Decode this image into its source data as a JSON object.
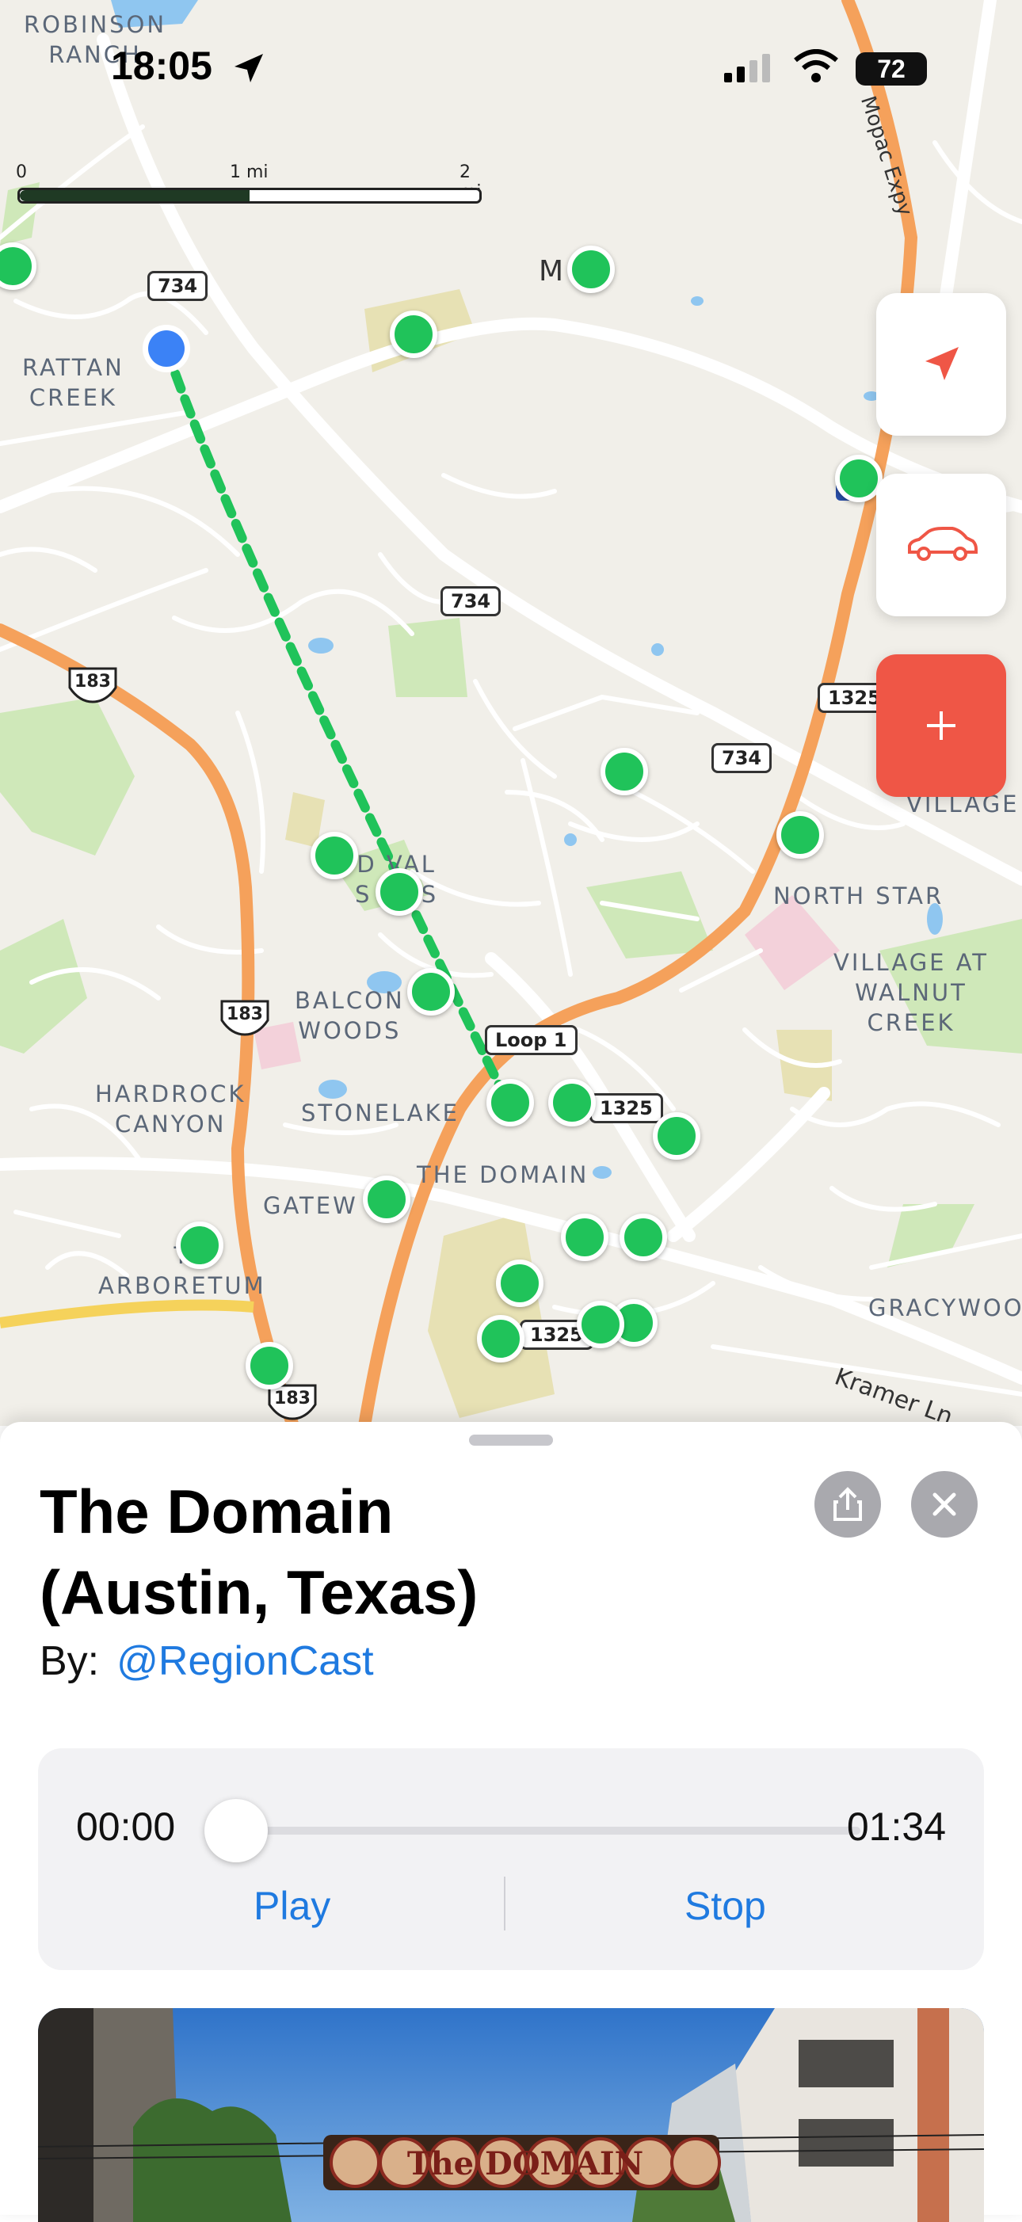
{
  "status_bar": {
    "time": "18:05",
    "battery": "72"
  },
  "scale": {
    "labels": [
      "0",
      "1 mi",
      "2 mi"
    ]
  },
  "map": {
    "places": [
      "ROBINSON\nRANCH",
      "RATTAN\nCREEK",
      "D VAL\nS NGS",
      "BALCON\nWOODS",
      "HARDROCK\nCANYON",
      "STONELAKE",
      "THE DOMAIN",
      "GATEW",
      "T\nARBORETUM",
      "NORTH STAR",
      "VILLAGE AT\nWALNUT\nCREEK",
      "VILLAGE",
      "GRACYWOO",
      "M eil"
    ],
    "roads": [
      "Mopac Expy",
      "Kramer Ln"
    ],
    "shields": [
      "734",
      "734",
      "734",
      "1325",
      "1325",
      "1325",
      "Loop 1"
    ],
    "us_shields": [
      "183",
      "183",
      "183"
    ]
  },
  "sheet": {
    "title": "The Domain\n(Austin, Texas)",
    "by_label": "By:",
    "author": "@RegionCast",
    "player": {
      "current_time": "00:00",
      "duration": "01:34",
      "progress": 0,
      "play_label": "Play",
      "stop_label": "Stop"
    },
    "photo_sign": "The DOMAIN"
  },
  "colors": {
    "pin": "#20c35a",
    "accent": "#1f7ae0",
    "add_button": "#ef5646",
    "user_dot": "#3b82f6"
  }
}
